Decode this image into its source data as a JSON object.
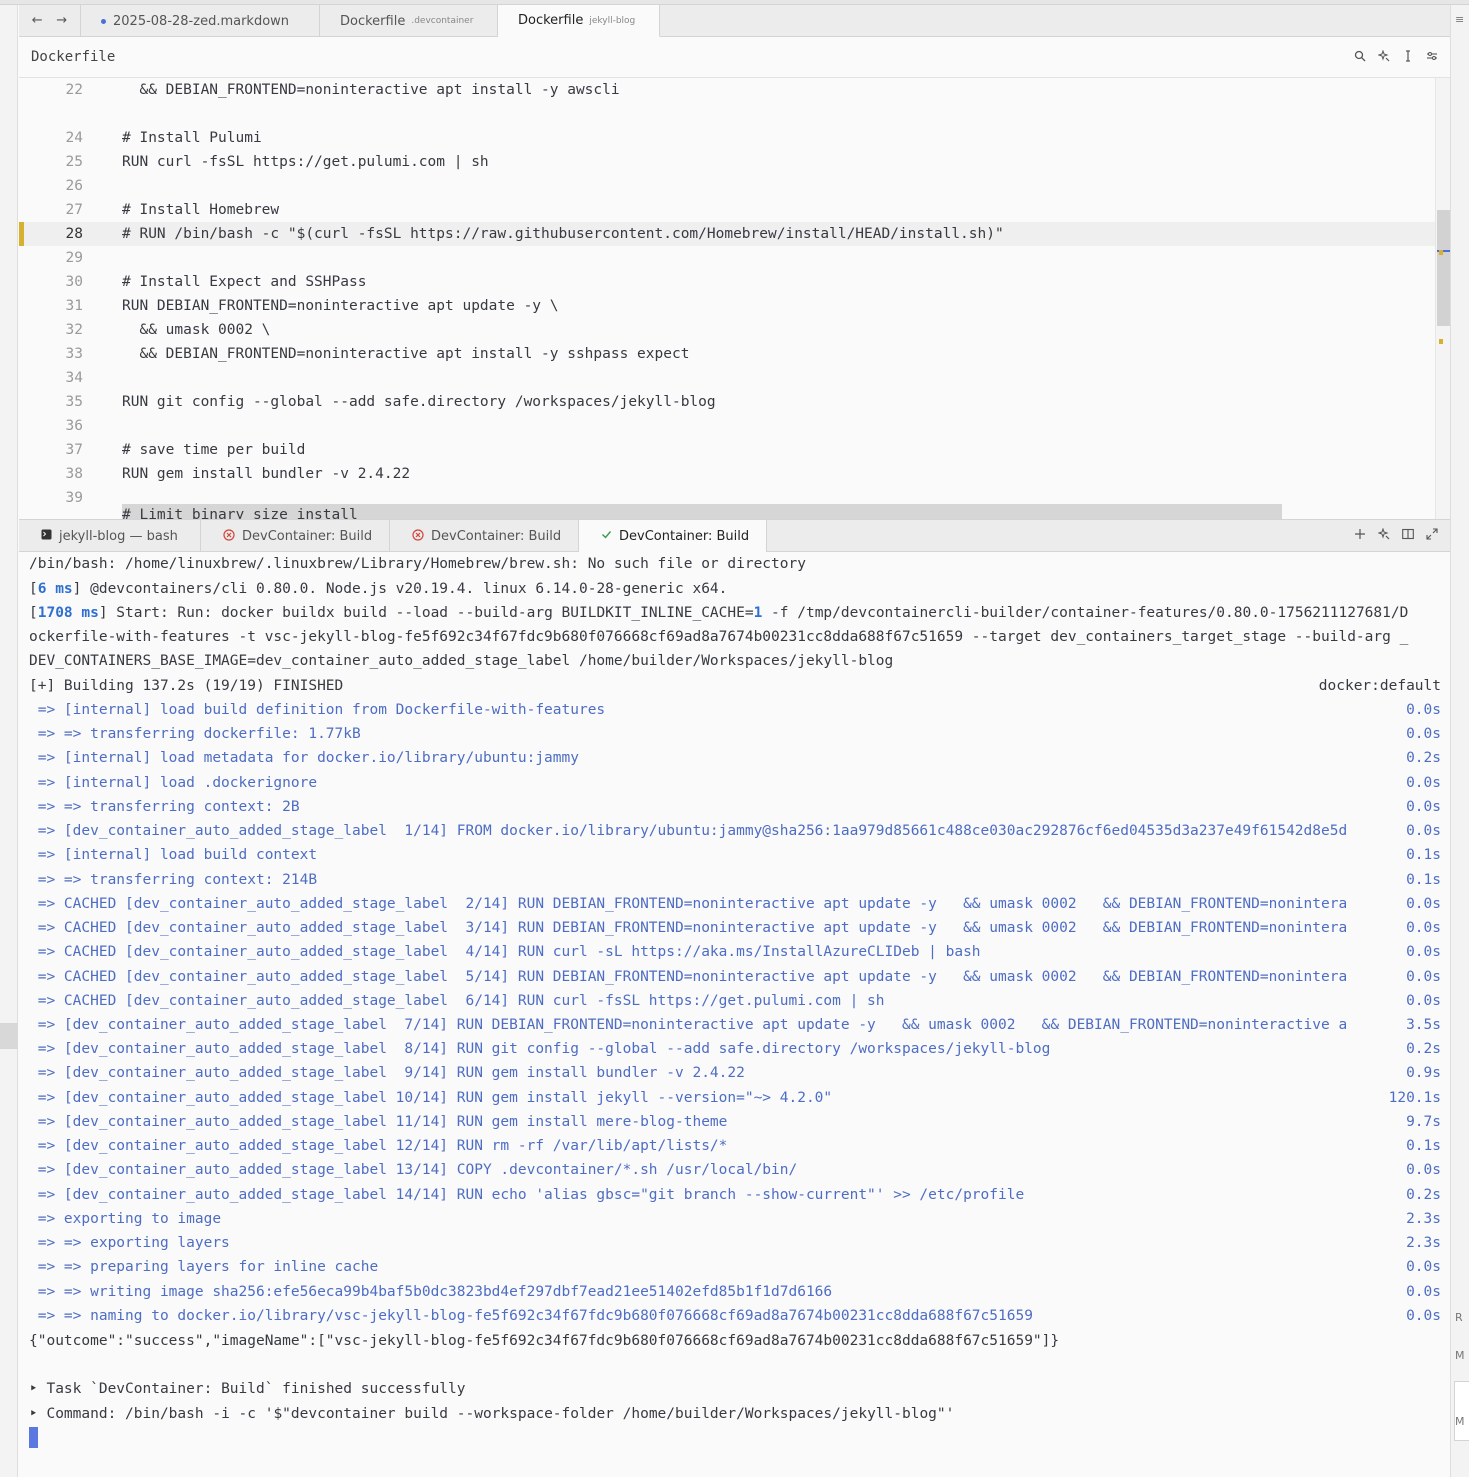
{
  "nav": {
    "back": "←",
    "forward": "→"
  },
  "tabs": [
    {
      "label": "2025-08-28-zed.markdown",
      "sub": "",
      "modified": true
    },
    {
      "label": "Dockerfile",
      "sub": ".devcontainer",
      "modified": false
    },
    {
      "label": "Dockerfile",
      "sub": "jekyll-blog",
      "modified": false,
      "active": true
    }
  ],
  "breadcrumb": {
    "title": "Dockerfile"
  },
  "editor": {
    "lines": [
      {
        "n": "22",
        "text": "  && DEBIAN_FRONTEND=noninteractive apt install -y awscli"
      },
      {
        "n": "",
        "text": ""
      },
      {
        "n": "24",
        "text": "# Install Pulumi"
      },
      {
        "n": "25",
        "text": "RUN curl -fsSL https://get.pulumi.com | sh"
      },
      {
        "n": "26",
        "text": ""
      },
      {
        "n": "27",
        "text": "# Install Homebrew"
      },
      {
        "n": "28",
        "text": "# RUN /bin/bash -c \"$(curl -fsSL https://raw.githubusercontent.com/Homebrew/install/HEAD/install.sh)\""
      },
      {
        "n": "29",
        "text": ""
      },
      {
        "n": "30",
        "text": "# Install Expect and SSHPass"
      },
      {
        "n": "31",
        "text": "RUN DEBIAN_FRONTEND=noninteractive apt update -y \\"
      },
      {
        "n": "32",
        "text": "  && umask 0002 \\"
      },
      {
        "n": "33",
        "text": "  && DEBIAN_FRONTEND=noninteractive apt install -y sshpass expect"
      },
      {
        "n": "34",
        "text": ""
      },
      {
        "n": "35",
        "text": "RUN git config --global --add safe.directory /workspaces/jekyll-blog"
      },
      {
        "n": "36",
        "text": ""
      },
      {
        "n": "37",
        "text": "# save time per build"
      },
      {
        "n": "38",
        "text": "RUN gem install bundler -v 2.4.22"
      },
      {
        "n": "39",
        "text": ""
      }
    ],
    "partial_line": "# Limit binary size install"
  },
  "terminal_tabs": [
    {
      "label": "jekyll-blog — bash",
      "status": "terminal"
    },
    {
      "label": "DevContainer: Build",
      "status": "error"
    },
    {
      "label": "DevContainer: Build",
      "status": "error"
    },
    {
      "label": "DevContainer: Build",
      "status": "success",
      "active": true
    }
  ],
  "terminal": {
    "l1": "/bin/bash: /home/linuxbrew/.linuxbrew/Library/Homebrew/brew.sh: No such file or directory",
    "l2_ms": "6 ms",
    "l2_rest": " @devcontainers/cli 0.80.0. Node.js v20.19.4. linux 6.14.0-28-generic x64.",
    "l3_ms": "1708 ms",
    "l3_pre": " Start: Run: docker buildx build --load --build-arg BUILDKIT_INLINE_CACHE=",
    "l3_one": "1",
    "l3_post": " -f /tmp/devcontainercli-builder/container-features/0.80.0-1756211127681/D",
    "l4": "ockerfile-with-features -t vsc-jekyll-blog-fe5f692c34f67fdc9b680f076668cf69ad8a7674b00231cc8dda688f67c51659 --target dev_containers_target_stage --build-arg _",
    "l5": "DEV_CONTAINERS_BASE_IMAGE=dev_container_auto_added_stage_label /home/builder/Workspaces/jekyll-blog",
    "building": "[+] Building 137.2s (19/19) FINISHED",
    "builder": "docker:default",
    "steps": [
      {
        "text": " => [internal] load build definition from Dockerfile-with-features",
        "time": "0.0s"
      },
      {
        "text": " => => transferring dockerfile: 1.77kB",
        "time": "0.0s"
      },
      {
        "text": " => [internal] load metadata for docker.io/library/ubuntu:jammy",
        "time": "0.2s"
      },
      {
        "text": " => [internal] load .dockerignore",
        "time": "0.0s"
      },
      {
        "text": " => => transferring context: 2B",
        "time": "0.0s"
      },
      {
        "text": " => [dev_container_auto_added_stage_label  1/14] FROM docker.io/library/ubuntu:jammy@sha256:1aa979d85661c488ce030ac292876cf6ed04535d3a237e49f61542d8e5d",
        "time": "0.0s"
      },
      {
        "text": " => [internal] load build context",
        "time": "0.1s"
      },
      {
        "text": " => => transferring context: 214B",
        "time": "0.1s"
      },
      {
        "text": " => CACHED [dev_container_auto_added_stage_label  2/14] RUN DEBIAN_FRONTEND=noninteractive apt update -y   && umask 0002   && DEBIAN_FRONTEND=nonintera",
        "time": "0.0s"
      },
      {
        "text": " => CACHED [dev_container_auto_added_stage_label  3/14] RUN DEBIAN_FRONTEND=noninteractive apt update -y   && umask 0002   && DEBIAN_FRONTEND=nonintera",
        "time": "0.0s"
      },
      {
        "text": " => CACHED [dev_container_auto_added_stage_label  4/14] RUN curl -sL https://aka.ms/InstallAzureCLIDeb | bash",
        "time": "0.0s"
      },
      {
        "text": " => CACHED [dev_container_auto_added_stage_label  5/14] RUN DEBIAN_FRONTEND=noninteractive apt update -y   && umask 0002   && DEBIAN_FRONTEND=nonintera",
        "time": "0.0s"
      },
      {
        "text": " => CACHED [dev_container_auto_added_stage_label  6/14] RUN curl -fsSL https://get.pulumi.com | sh",
        "time": "0.0s"
      },
      {
        "text": " => [dev_container_auto_added_stage_label  7/14] RUN DEBIAN_FRONTEND=noninteractive apt update -y   && umask 0002   && DEBIAN_FRONTEND=noninteractive a",
        "time": "3.5s"
      },
      {
        "text": " => [dev_container_auto_added_stage_label  8/14] RUN git config --global --add safe.directory /workspaces/jekyll-blog",
        "time": "0.2s"
      },
      {
        "text": " => [dev_container_auto_added_stage_label  9/14] RUN gem install bundler -v 2.4.22",
        "time": "0.9s"
      },
      {
        "text": " => [dev_container_auto_added_stage_label 10/14] RUN gem install jekyll --version=\"~> 4.2.0\"",
        "time": "120.1s"
      },
      {
        "text": " => [dev_container_auto_added_stage_label 11/14] RUN gem install mere-blog-theme",
        "time": "9.7s"
      },
      {
        "text": " => [dev_container_auto_added_stage_label 12/14] RUN rm -rf /var/lib/apt/lists/*",
        "time": "0.1s"
      },
      {
        "text": " => [dev_container_auto_added_stage_label 13/14] COPY .devcontainer/*.sh /usr/local/bin/",
        "time": "0.0s"
      },
      {
        "text": " => [dev_container_auto_added_stage_label 14/14] RUN echo 'alias gbsc=\"git branch --show-current\"' >> /etc/profile",
        "time": "0.2s"
      },
      {
        "text": " => exporting to image",
        "time": "2.3s"
      },
      {
        "text": " => => exporting layers",
        "time": "2.3s"
      },
      {
        "text": " => => preparing layers for inline cache",
        "time": "0.0s"
      },
      {
        "text": " => => writing image sha256:efe56eca99b4baf5b0dc3823bd4ef297dbf7ead21ee51402efd85b1f1d7d6166",
        "time": "0.0s"
      },
      {
        "text": " => => naming to docker.io/library/vsc-jekyll-blog-fe5f692c34f67fdc9b680f076668cf69ad8a7674b00231cc8dda688f67c51659",
        "time": "0.0s"
      }
    ],
    "outcome": "{\"outcome\":\"success\",\"imageName\":[\"vsc-jekyll-blog-fe5f692c34f67fdc9b680f076668cf69ad8a7674b00231cc8dda688f67c51659\"]}",
    "task_done": "Task `DevContainer: Build` finished successfully",
    "command": "Command: /bin/bash -i -c '$\"devcontainer build --workspace-folder /home/builder/Workspaces/jekyll-blog\"'"
  },
  "colors": {
    "accent": "#4a6fdc",
    "git_modified": "#d8b030",
    "error": "#d0453b",
    "success": "#3a9a4a",
    "log_blue": "#4e6dc4"
  },
  "icons": {
    "search": "search-icon",
    "assistant": "sparkle-icon",
    "cursor": "text-cursor-icon",
    "settings": "sliders-icon",
    "add": "plus-icon",
    "split": "split-pane-icon",
    "maximize": "maximize-icon"
  },
  "right_strip": {
    "top_glyph": "≡",
    "g1": "R",
    "g2": "M",
    "g3": "M"
  }
}
